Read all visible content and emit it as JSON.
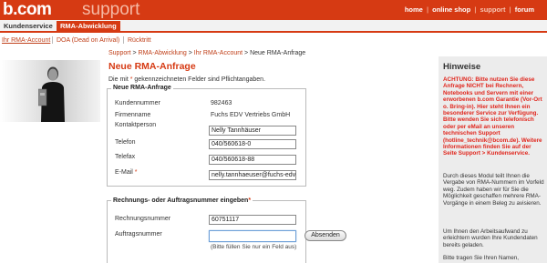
{
  "header": {
    "logo": "b.com",
    "logo_sub": "support",
    "nav": {
      "home": "home",
      "online_shop": "online shop",
      "support": "support",
      "forum": "forum",
      "sep": "|"
    }
  },
  "tabs": {
    "kundenservice": "Kundenservice",
    "rma": "RMA-Abwicklung"
  },
  "subnav": {
    "rma_account": "Ihr RMA-Account",
    "doa": "DOA (Dead on Arrival)",
    "ruecktritt": "Rücktritt"
  },
  "breadcrumb": {
    "support": "Support",
    "rma": "RMA-Abwicklung",
    "account": "Ihr RMA-Account",
    "current": "Neue RMA-Anfrage",
    "sep": " > "
  },
  "page": {
    "title": "Neue RMA-Anfrage",
    "required_pre": "Die mit ",
    "required_star": "*",
    "required_post": " gekennzeichneten Felder sind Pflichtangaben."
  },
  "form_new": {
    "legend": "Neue RMA-Anfrage",
    "kundennummer_label": "Kundennummer",
    "kundennummer_value": "982463",
    "firmenname_label": "Firmenname",
    "firmenname_value": "Fuchs EDV Vertriebs GmbH",
    "kontakt_label": "Kontaktperson",
    "kontakt_value": "Nelly Tannhäuser",
    "telefon_label": "Telefon",
    "telefon_value": "040/560618-0",
    "telefax_label": "Telefax",
    "telefax_value": "040/560618-88",
    "email_label": "E-Mail",
    "email_star": "*",
    "email_value": "nelly.tannhaeuser@fuchs-edv"
  },
  "form_invoice": {
    "legend": "Rechnungs- oder Auftragsnummer eingeben",
    "legend_star": "*",
    "rechnung_label": "Rechnungsnummer",
    "rechnung_value": "60751117",
    "auftrag_label": "Auftragsnummer",
    "auftrag_value": "",
    "submit_label": "Absenden",
    "hint": "(Bitte füllen Sie nur ein Feld aus)"
  },
  "sidebar": {
    "title": "Hinweise",
    "warning": "ACHTUNG: Bitte nutzen Sie diese Anfrage NICHT bei Rechnern, Notebooks und Servern mit einer erworbenen b.com Garantie (Vor-Ort o. Bring-in). Hier steht Ihnen ein besonderer Service zur Verfügung. Bitte wenden Sie sich telefonisch oder per eMail an unseren technischen Support (hotline_technik@bcom.de). Weitere Informationen finden Sie auf der Seite Support > Kundenservice.",
    "info1": "Durch dieses Modul teilt Ihnen die Vergabe von RMA-Nummern im Vorfeld weg. Zudem haben wir für Sie die Möglichkeit geschaffen mehrere RMA-Vorgänge in einem Beleg zu avisieren.",
    "info2": "Um Ihnen den Arbeitsaufwand zu erleichtern wurden Ihre Kundendaten bereits geladen.",
    "info3": "Bitte tragen Sie Ihren Namen,"
  },
  "colors": {
    "brand": "#d63a13",
    "warning_text": "#e0261d",
    "link": "#c0401a"
  }
}
